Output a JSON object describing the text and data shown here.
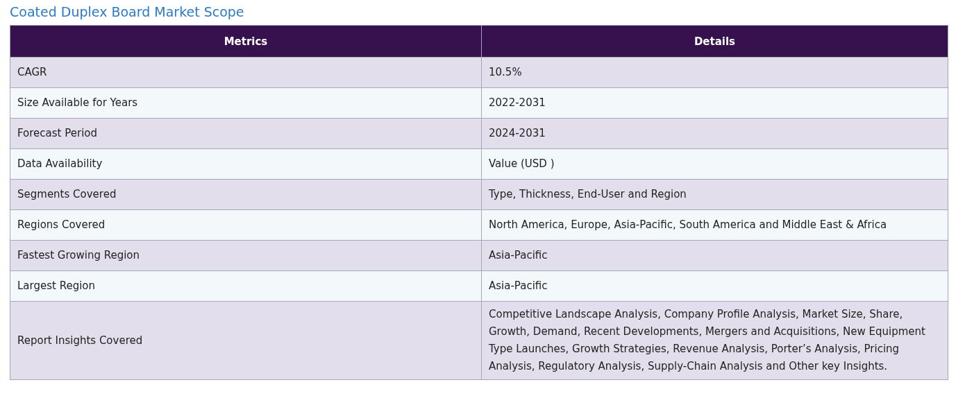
{
  "title": "Coated Duplex Board Market Scope",
  "table": {
    "columns": [
      "Metrics",
      "Details"
    ],
    "rows": [
      {
        "metric": "CAGR",
        "details": "10.5%"
      },
      {
        "metric": "Size Available for Years",
        "details": "2022-2031"
      },
      {
        "metric": "Forecast Period",
        "details": "2024-2031"
      },
      {
        "metric": "Data Availability",
        "details": "Value (USD )"
      },
      {
        "metric": "Segments Covered",
        "details": "Type, Thickness, End-User and Region"
      },
      {
        "metric": "Regions Covered",
        "details": "North America, Europe, Asia-Pacific, South America and Middle East & Africa"
      },
      {
        "metric": "Fastest Growing Region",
        "details": "Asia-Pacific"
      },
      {
        "metric": "Largest Region",
        "details": "Asia-Pacific"
      },
      {
        "metric": "Report Insights Covered",
        "details": "Competitive Landscape Analysis, Company Profile Analysis, Market Size, Share, Growth, Demand, Recent Developments, Mergers and Acquisitions, New Equipment Type Launches, Growth Strategies, Revenue Analysis, Porter’s Analysis, Pricing Analysis, Regulatory Analysis, Supply-Chain Analysis and Other key Insights."
      }
    ]
  }
}
